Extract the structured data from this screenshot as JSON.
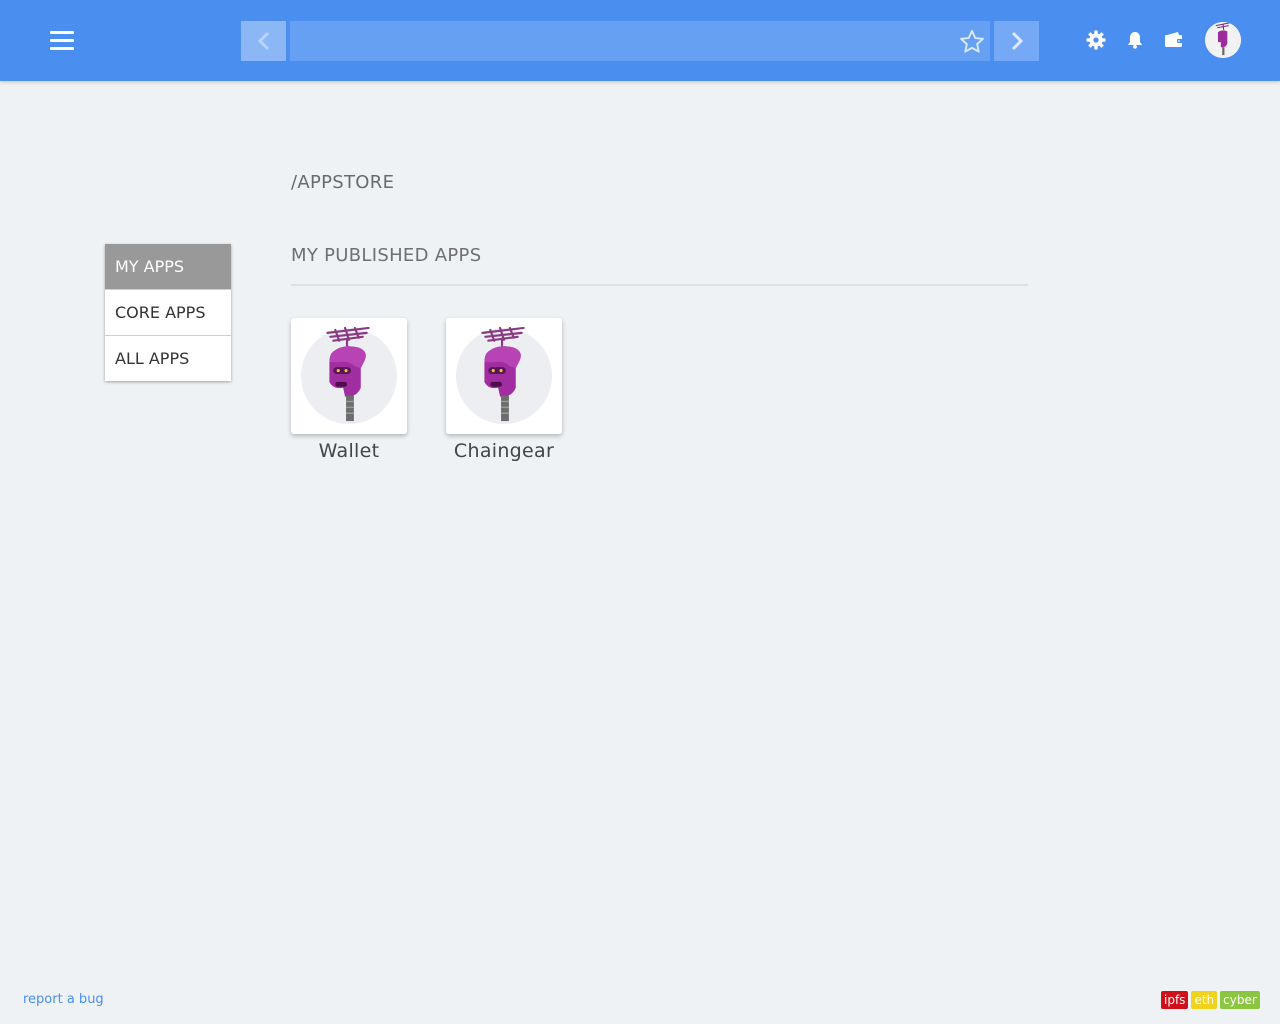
{
  "header": {
    "address_value": "",
    "address_placeholder": "",
    "icons": [
      "menu-icon",
      "chevron-left-icon",
      "star-icon",
      "chevron-right-icon",
      "gear-icon",
      "bell-icon",
      "wallet-icon",
      "avatar"
    ],
    "bar_color": "#4a8ef0"
  },
  "page": {
    "title": "/APPSTORE"
  },
  "sidebar": {
    "items": [
      {
        "label": "MY APPS",
        "active": true
      },
      {
        "label": "CORE APPS",
        "active": false
      },
      {
        "label": "ALL APPS",
        "active": false
      }
    ]
  },
  "main": {
    "section_title": "MY PUBLISHED APPS",
    "apps": [
      {
        "name": "Wallet",
        "icon": "robot-icon"
      },
      {
        "name": "Chaingear",
        "icon": "robot-icon"
      }
    ]
  },
  "footer": {
    "report_link": "report a bug",
    "badges": [
      {
        "label": "ipfs",
        "color": "#d0101b"
      },
      {
        "label": "eth",
        "color": "#f0d31a"
      },
      {
        "label": "cyber",
        "color": "#8bc63f"
      }
    ]
  }
}
